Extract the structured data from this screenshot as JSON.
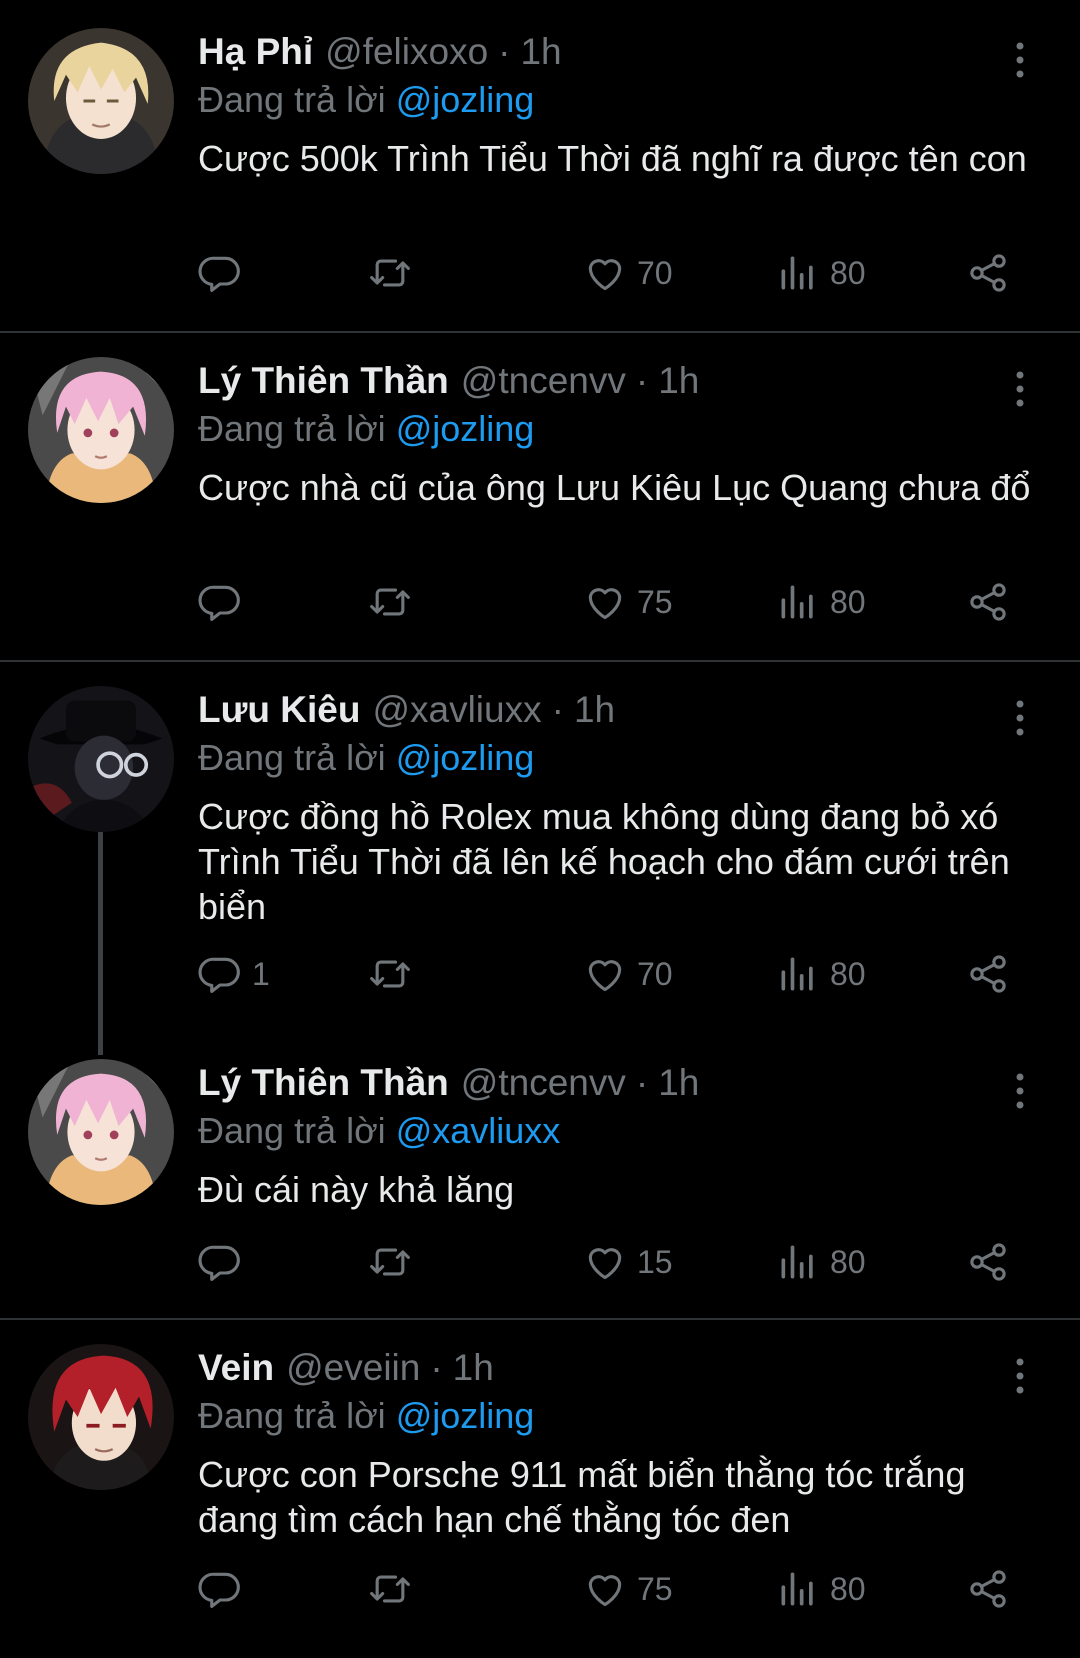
{
  "colors": {
    "background": "#000000",
    "text": "#e7e9ea",
    "muted": "#71767b",
    "mention": "#1d9bf0",
    "divider": "#2f3336"
  },
  "tweets": [
    {
      "name": "Hạ Phỉ",
      "handle": "@felixoxo",
      "sep": "·",
      "time": "1h",
      "reply_prefix": "Đang trả lời",
      "reply_to": "@jozling",
      "text": "Cược 500k Trình Tiểu Thời đã nghĩ ra được tên con",
      "replies": "",
      "likes": "70",
      "views": "80",
      "avatar": "blonde-anime-avatar"
    },
    {
      "name": "Lý Thiên Thần",
      "handle": "@tncenvv",
      "sep": "·",
      "time": "1h",
      "reply_prefix": "Đang trả lời",
      "reply_to": "@jozling",
      "text": "Cược nhà cũ của ông Lưu Kiêu Lục Quang chưa đổ",
      "replies": "",
      "likes": "75",
      "views": "80",
      "avatar": "pink-hair-anime-avatar"
    },
    {
      "name": "Lưu Kiêu",
      "handle": "@xavliuxx",
      "sep": "·",
      "time": "1h",
      "reply_prefix": "Đang trả lời",
      "reply_to": "@jozling",
      "text": "Cược đồng hồ Rolex mua không dùng đang bỏ xó Trình Tiểu Thời đã lên kế hoạch cho đám cưới trên biển",
      "replies": "1",
      "likes": "70",
      "views": "80",
      "avatar": "dark-hat-glasses-anime-avatar"
    },
    {
      "name": "Lý Thiên Thần",
      "handle": "@tncenvv",
      "sep": "·",
      "time": "1h",
      "reply_prefix": "Đang trả lời",
      "reply_to": "@xavliuxx",
      "text": "Đù cái này khả lăng",
      "replies": "",
      "likes": "15",
      "views": "80",
      "avatar": "pink-hair-anime-avatar"
    },
    {
      "name": "Vein",
      "handle": "@eveiin",
      "sep": "·",
      "time": "1h",
      "reply_prefix": "Đang trả lời",
      "reply_to": "@jozling",
      "text": "Cược con Porsche 911 mất biển thằng tóc trắng đang tìm cách hạn chế thằng tóc đen",
      "replies": "",
      "likes": "75",
      "views": "80",
      "avatar": "red-hair-anime-avatar"
    }
  ]
}
